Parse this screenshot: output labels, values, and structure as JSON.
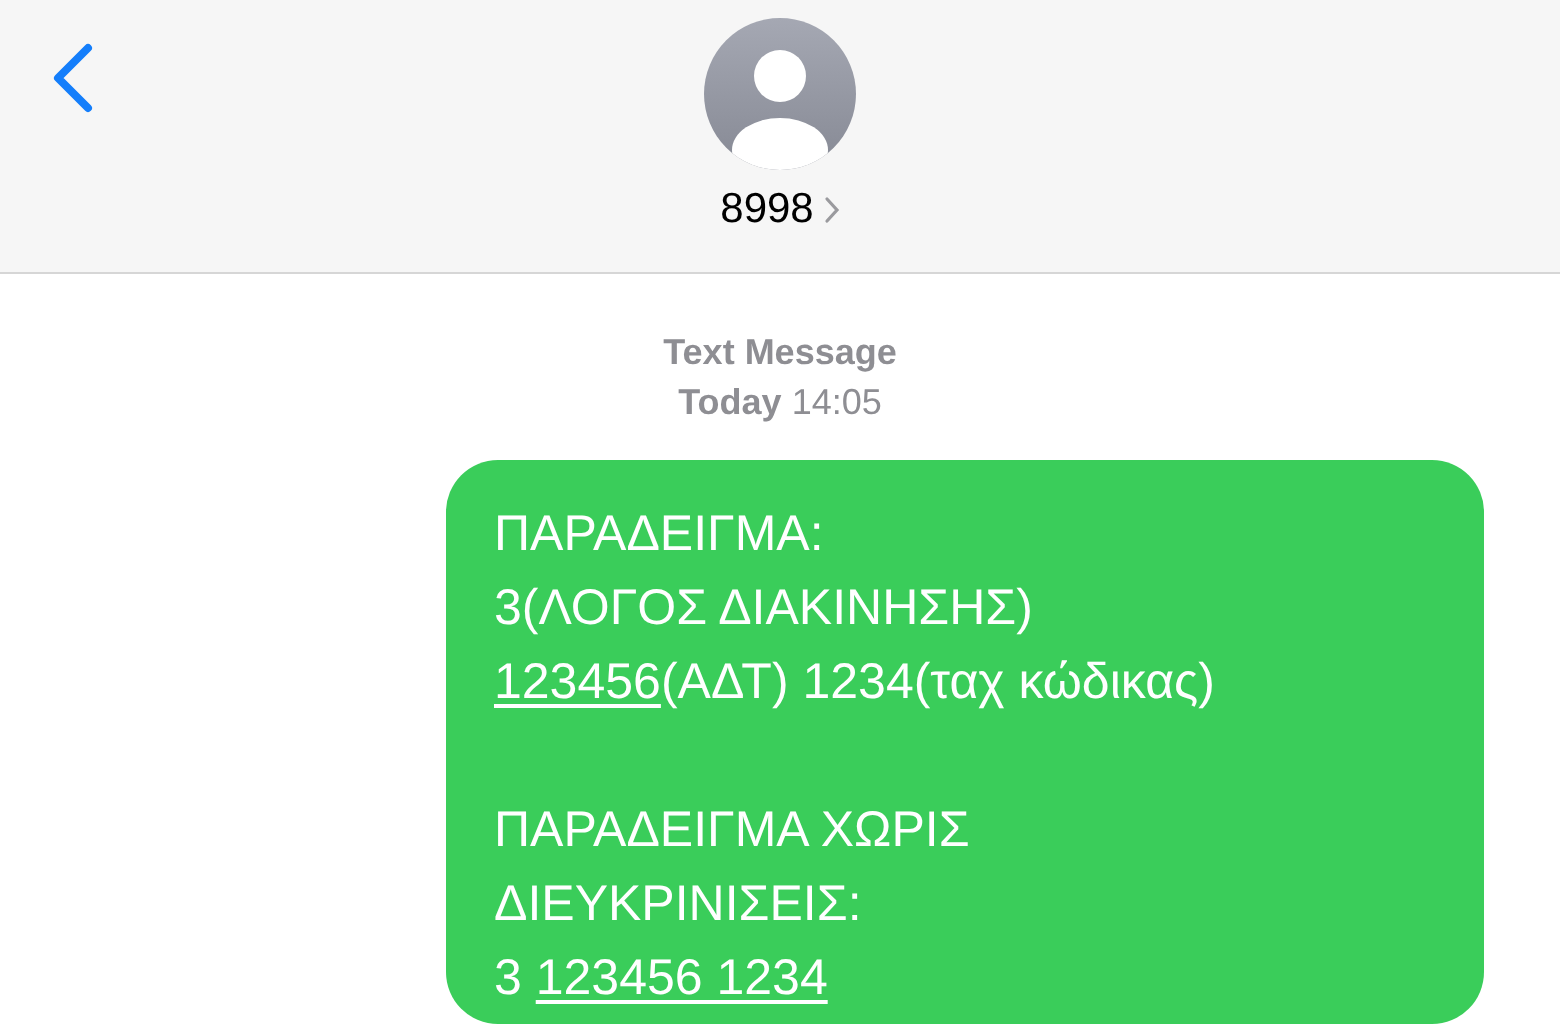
{
  "header": {
    "contact": "8998"
  },
  "thread": {
    "service": "Text Message",
    "day": "Today",
    "time": "14:05"
  },
  "message": {
    "paragraphs": [
      [
        [
          {
            "text": "ΠΑΡΑΔΕΙΓΜΑ:",
            "link": false
          }
        ],
        [
          {
            "text": "3(ΛΟΓΟΣ ΔΙΑΚΙΝΗΣΗΣ)",
            "link": false
          }
        ],
        [
          {
            "text": "123456",
            "link": true
          },
          {
            "text": "(ΑΔΤ) 1234(ταχ κώδικας)",
            "link": false
          }
        ]
      ],
      [
        [
          {
            "text": "ΠΑΡΑΔΕΙΓΜΑ ΧΩΡΙΣ",
            "link": false
          }
        ],
        [
          {
            "text": "ΔΙΕΥΚΡΙΝΙΣΕΙΣ:",
            "link": false
          }
        ],
        [
          {
            "text": "3 ",
            "link": false
          },
          {
            "text": "123456 1234",
            "link": true
          }
        ]
      ]
    ]
  }
}
